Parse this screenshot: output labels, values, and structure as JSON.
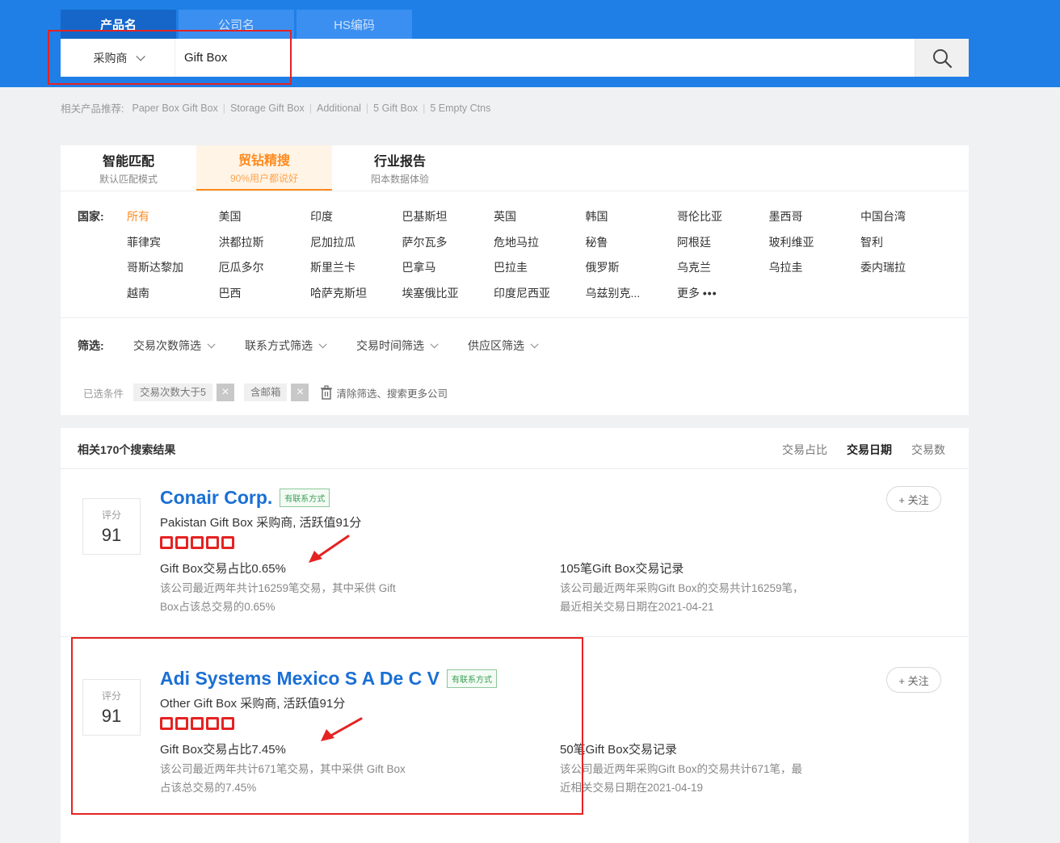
{
  "search": {
    "tabs": [
      "产品名",
      "公司名",
      "HS编码"
    ],
    "active_tab": 0,
    "buyer_select": "采购商",
    "query": "Gift Box"
  },
  "suggestions": {
    "label": "相关产品推荐:",
    "items": [
      "Paper Box Gift Box",
      "Storage Gift Box",
      "Additional",
      "5 Gift Box",
      "5 Empty Ctns"
    ]
  },
  "modes": [
    {
      "title": "智能匹配",
      "subtitle": "默认匹配模式"
    },
    {
      "title": "贸钻精搜",
      "subtitle": "90%用户都说好"
    },
    {
      "title": "行业报告",
      "subtitle": "阳本数据体验"
    }
  ],
  "countries": {
    "label": "国家:",
    "items": [
      "所有",
      "美国",
      "印度",
      "巴基斯坦",
      "英国",
      "韩国",
      "哥伦比亚",
      "墨西哥",
      "中国台湾",
      "菲律宾",
      "洪都拉斯",
      "尼加拉瓜",
      "萨尔瓦多",
      "危地马拉",
      "秘鲁",
      "阿根廷",
      "玻利维亚",
      "智利",
      "哥斯达黎加",
      "厄瓜多尔",
      "斯里兰卡",
      "巴拿马",
      "巴拉圭",
      "俄罗斯",
      "乌克兰",
      "乌拉圭",
      "委内瑞拉",
      "越南",
      "巴西",
      "哈萨克斯坦",
      "埃塞俄比亚",
      "印度尼西亚",
      "乌兹别克..."
    ],
    "more": "更多",
    "more_dots": "•••"
  },
  "filters": {
    "label": "筛选:",
    "dropdowns": [
      "交易次数筛选",
      "联系方式筛选",
      "交易时间筛选",
      "供应区筛选"
    ],
    "chosen_label": "已选条件",
    "chips": [
      "交易次数大于5",
      "含邮箱"
    ],
    "clear": "清除筛选、搜索更多公司"
  },
  "results": {
    "count_text": "相关170个搜索结果",
    "sort": [
      "交易占比",
      "交易日期",
      "交易数"
    ],
    "active_sort": 1,
    "items": [
      {
        "score_label": "评分",
        "score": "91",
        "company": "Conair Corp.",
        "tag": "有联系方式",
        "subline": "Pakistan Gift Box 采购商, 活跃值91分",
        "share_title": "Gift Box交易占比0.65%",
        "share_desc_1": "该公司最近两年共计16259笔交易，其中采供 Gift",
        "share_desc_2": "Box占该总交易的0.65%",
        "record_title": "105笔Gift Box交易记录",
        "record_desc_1": "该公司最近两年采购Gift Box的交易共计16259笔，",
        "record_desc_2": "最近相关交易日期在2021-04-21",
        "follow": "+ 关注"
      },
      {
        "score_label": "评分",
        "score": "91",
        "company": "Adi Systems Mexico S A De C V",
        "tag": "有联系方式",
        "subline": "Other Gift Box 采购商, 活跃值91分",
        "share_title": "Gift Box交易占比7.45%",
        "share_desc_1": "该公司最近两年共计671笔交易，其中采供 Gift Box",
        "share_desc_2": "占该总交易的7.45%",
        "record_title": "50笔Gift Box交易记录",
        "record_desc_1": "该公司最近两年采购Gift Box的交易共计671笔，最",
        "record_desc_2": "近相关交易日期在2021-04-19",
        "follow": "+ 关注"
      }
    ]
  },
  "colors": {
    "header": "#1f7fe6",
    "accent_orange": "#ff8a1f",
    "company_blue": "#1a6fd4",
    "annotation_red": "#e52222"
  }
}
